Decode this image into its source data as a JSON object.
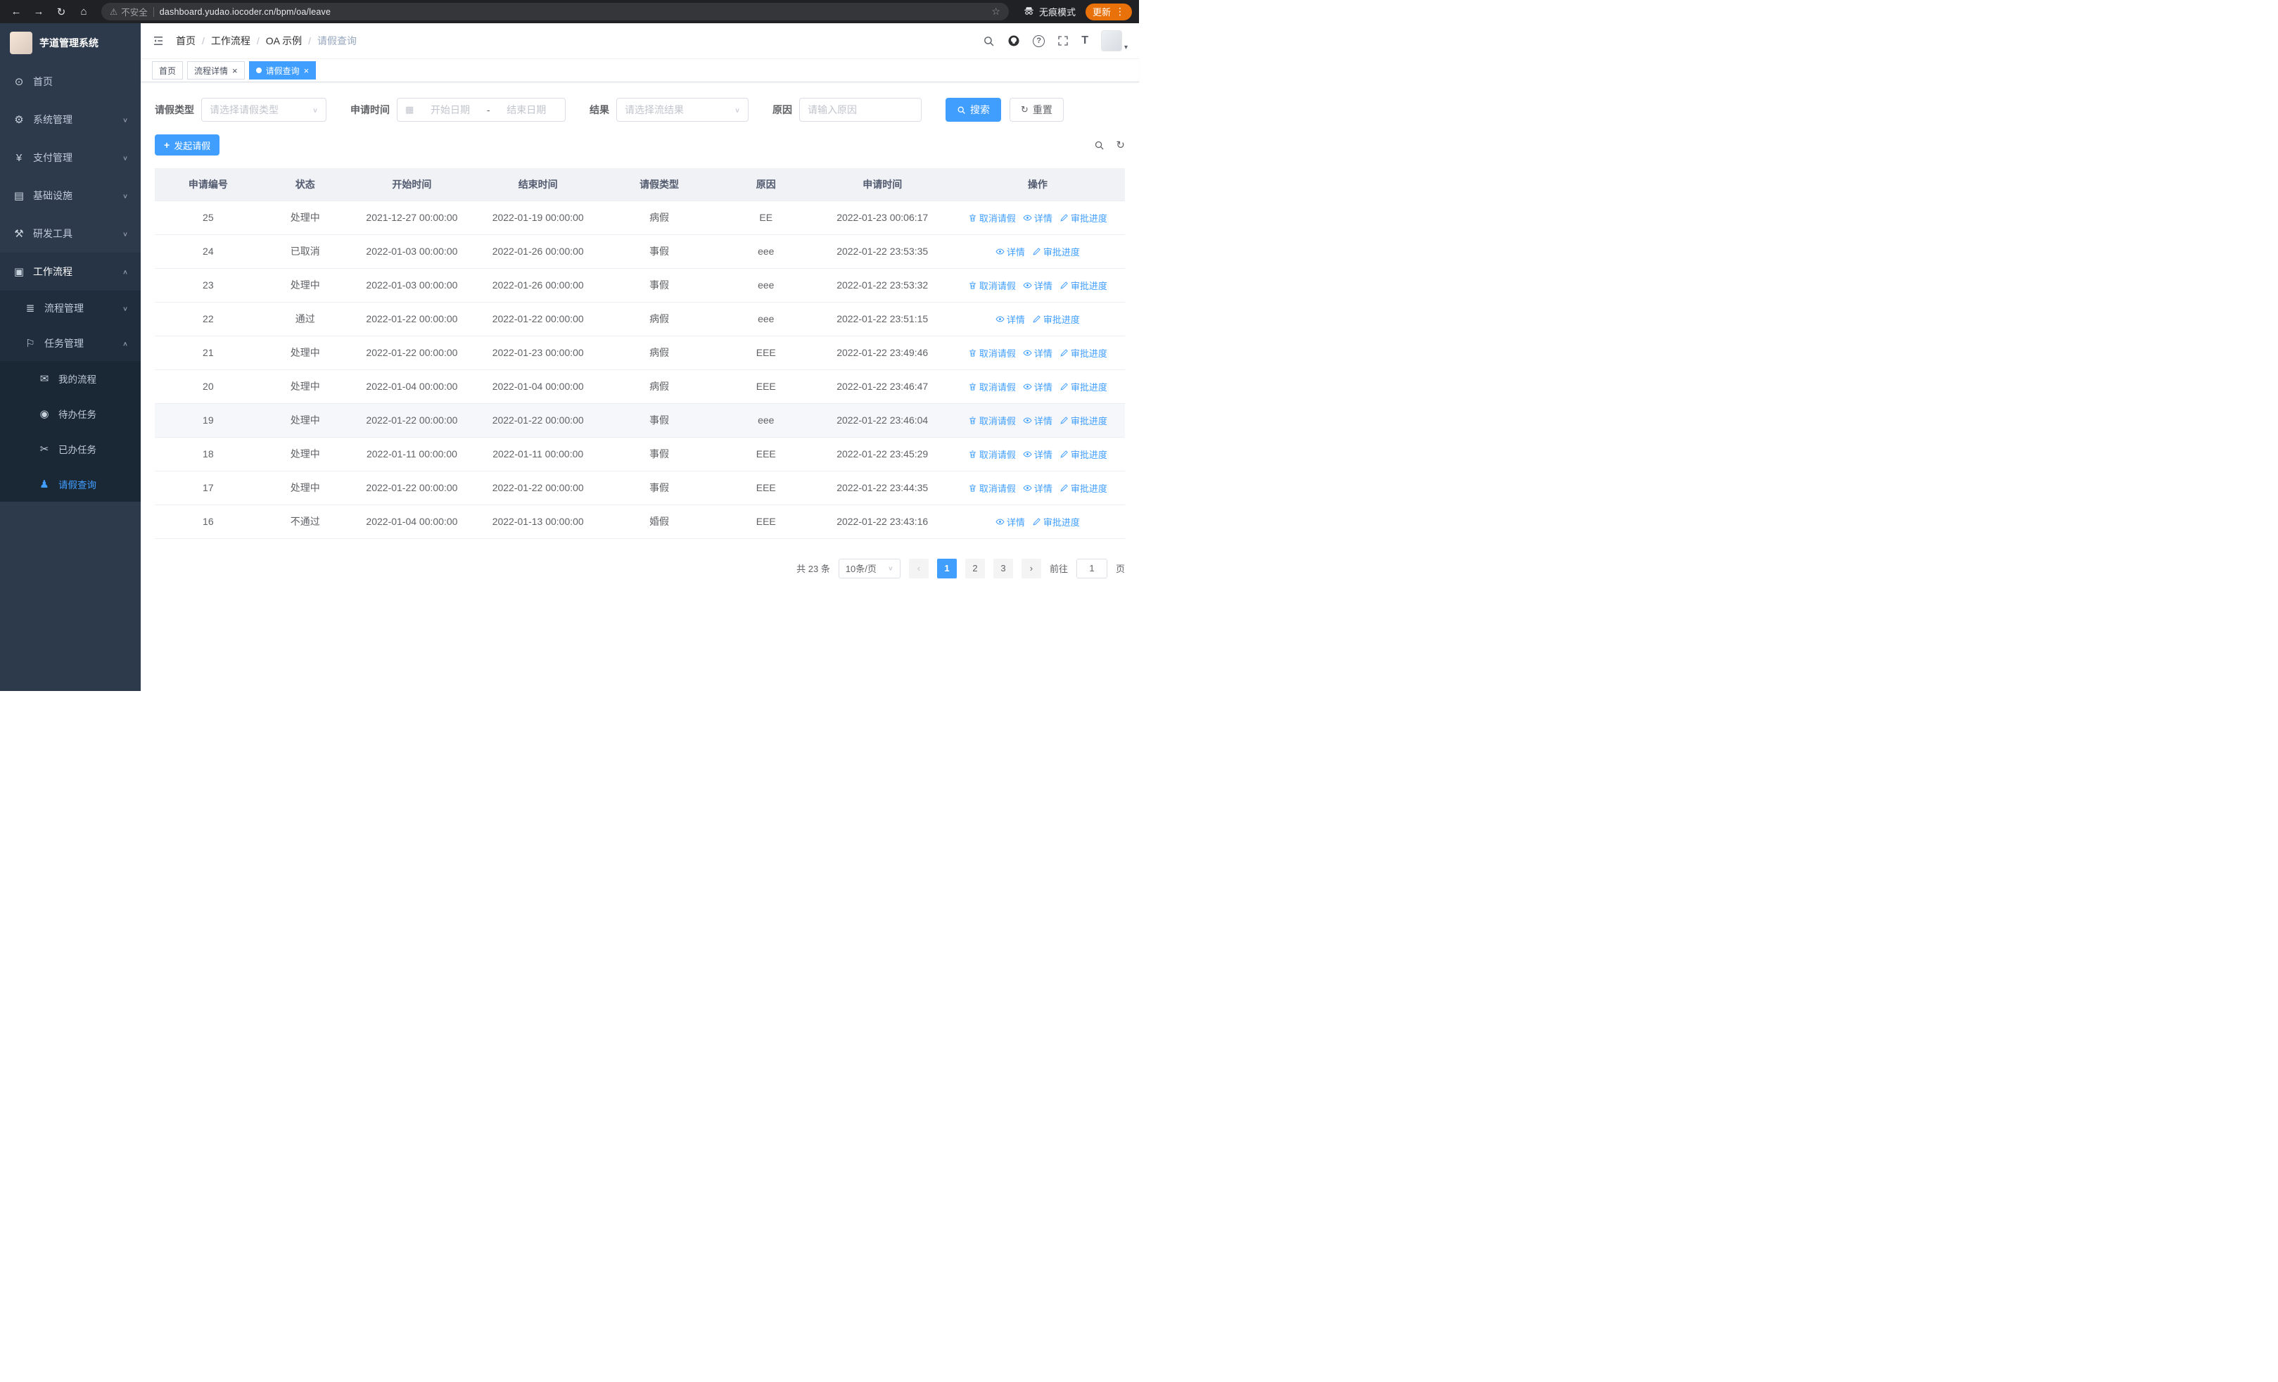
{
  "browser": {
    "security_warning": "不安全",
    "url": "dashboard.yudao.iocoder.cn/bpm/oa/leave",
    "incognito_label": "无痕模式",
    "update_label": "更新"
  },
  "icons": {
    "back": "←",
    "forward": "→",
    "reload": "↻",
    "home": "⌂",
    "warning": "⚠",
    "star": "☆",
    "dots": "⋮",
    "dashboard": "⊙",
    "gear": "⚙",
    "payment": "¥",
    "infra": "▤",
    "tools": "⚒",
    "workflow": "▣",
    "process": "≣",
    "task": "⚐",
    "chat": "✉",
    "eye": "◉",
    "scissors": "✂",
    "person": "♟",
    "chevron_down": "∨",
    "chevron_up": "∧",
    "caret": "▾",
    "question": "?",
    "font_size": "T",
    "calendar": "▦",
    "plus": "+",
    "refresh": "↻",
    "close": "×",
    "prev": "‹",
    "next": "›"
  },
  "sidebar": {
    "logo_title": "芋道管理系统",
    "items": [
      {
        "label": "首页"
      },
      {
        "label": "系统管理"
      },
      {
        "label": "支付管理"
      },
      {
        "label": "基础设施"
      },
      {
        "label": "研发工具"
      },
      {
        "label": "工作流程"
      },
      {
        "label": "流程管理"
      },
      {
        "label": "任务管理"
      },
      {
        "label": "我的流程"
      },
      {
        "label": "待办任务"
      },
      {
        "label": "已办任务"
      },
      {
        "label": "请假查询"
      }
    ]
  },
  "header": {
    "breadcrumb": [
      "首页",
      "工作流程",
      "OA 示例",
      "请假查询"
    ],
    "separator": "/"
  },
  "tabs": [
    {
      "label": "首页"
    },
    {
      "label": "流程详情"
    },
    {
      "label": "请假查询"
    }
  ],
  "filters": {
    "leave_type_label": "请假类型",
    "leave_type_placeholder": "请选择请假类型",
    "apply_time_label": "申请时间",
    "start_date_placeholder": "开始日期",
    "range_separator": "-",
    "end_date_placeholder": "结束日期",
    "result_label": "结果",
    "result_placeholder": "请选择流结果",
    "reason_label": "原因",
    "reason_placeholder": "请输入原因",
    "search_button": "搜索",
    "reset_button": "重置"
  },
  "toolbar": {
    "create_button": "发起请假"
  },
  "table": {
    "columns": [
      "申请编号",
      "状态",
      "开始时间",
      "结束时间",
      "请假类型",
      "原因",
      "申请时间",
      "操作"
    ],
    "actions": {
      "cancel": "取消请假",
      "detail": "详情",
      "progress": "审批进度"
    },
    "rows": [
      {
        "id": "25",
        "status": "处理中",
        "start": "2021-12-27 00:00:00",
        "end": "2022-01-19 00:00:00",
        "type": "病假",
        "reason": "EE",
        "apply_time": "2022-01-23 00:06:17",
        "can_cancel": true
      },
      {
        "id": "24",
        "status": "已取消",
        "start": "2022-01-03 00:00:00",
        "end": "2022-01-26 00:00:00",
        "type": "事假",
        "reason": "eee",
        "apply_time": "2022-01-22 23:53:35",
        "can_cancel": false
      },
      {
        "id": "23",
        "status": "处理中",
        "start": "2022-01-03 00:00:00",
        "end": "2022-01-26 00:00:00",
        "type": "事假",
        "reason": "eee",
        "apply_time": "2022-01-22 23:53:32",
        "can_cancel": true
      },
      {
        "id": "22",
        "status": "通过",
        "start": "2022-01-22 00:00:00",
        "end": "2022-01-22 00:00:00",
        "type": "病假",
        "reason": "eee",
        "apply_time": "2022-01-22 23:51:15",
        "can_cancel": false
      },
      {
        "id": "21",
        "status": "处理中",
        "start": "2022-01-22 00:00:00",
        "end": "2022-01-23 00:00:00",
        "type": "病假",
        "reason": "EEE",
        "apply_time": "2022-01-22 23:49:46",
        "can_cancel": true
      },
      {
        "id": "20",
        "status": "处理中",
        "start": "2022-01-04 00:00:00",
        "end": "2022-01-04 00:00:00",
        "type": "病假",
        "reason": "EEE",
        "apply_time": "2022-01-22 23:46:47",
        "can_cancel": true
      },
      {
        "id": "19",
        "status": "处理中",
        "start": "2022-01-22 00:00:00",
        "end": "2022-01-22 00:00:00",
        "type": "事假",
        "reason": "eee",
        "apply_time": "2022-01-22 23:46:04",
        "can_cancel": true,
        "highlight": true
      },
      {
        "id": "18",
        "status": "处理中",
        "start": "2022-01-11 00:00:00",
        "end": "2022-01-11 00:00:00",
        "type": "事假",
        "reason": "EEE",
        "apply_time": "2022-01-22 23:45:29",
        "can_cancel": true
      },
      {
        "id": "17",
        "status": "处理中",
        "start": "2022-01-22 00:00:00",
        "end": "2022-01-22 00:00:00",
        "type": "事假",
        "reason": "EEE",
        "apply_time": "2022-01-22 23:44:35",
        "can_cancel": true
      },
      {
        "id": "16",
        "status": "不通过",
        "start": "2022-01-04 00:00:00",
        "end": "2022-01-13 00:00:00",
        "type": "婚假",
        "reason": "EEE",
        "apply_time": "2022-01-22 23:43:16",
        "can_cancel": false
      }
    ]
  },
  "pagination": {
    "total": "共 23 条",
    "page_size": "10条/页",
    "pages": [
      "1",
      "2",
      "3"
    ],
    "active_page": "1",
    "goto_label": "前往",
    "goto_value": "1",
    "page_unit": "页"
  }
}
